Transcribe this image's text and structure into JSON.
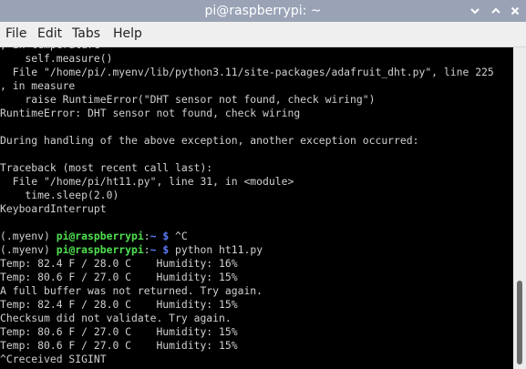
{
  "window": {
    "title": "pi@raspberrypi: ~",
    "controls": [
      "chevron-down-icon",
      "chevron-up-icon",
      "close-icon"
    ]
  },
  "menu": {
    "items": [
      "File",
      "Edit",
      "Tabs",
      "Help"
    ]
  },
  "terminal": {
    "lines": [
      ", in temperature",
      "    self.measure()",
      "  File \"/home/pi/.myenv/lib/python3.11/site-packages/adafruit_dht.py\", line 225",
      ", in measure",
      "    raise RuntimeError(\"DHT sensor not found, check wiring\")",
      "RuntimeError: DHT sensor not found, check wiring",
      "",
      "During handling of the above exception, another exception occurred:",
      "",
      "Traceback (most recent call last):",
      "  File \"/home/pi/ht11.py\", line 31, in <module>",
      "    time.sleep(2.0)",
      "KeyboardInterrupt",
      "",
      {
        "prompt": true,
        "env": "(.myenv) ",
        "host": "pi@raspberrypi",
        "sep": ":",
        "path": "~ $",
        "cmd": " ^C"
      },
      {
        "prompt": true,
        "env": "(.myenv) ",
        "host": "pi@raspberrypi",
        "sep": ":",
        "path": "~ $",
        "cmd": " python ht11.py"
      },
      "Temp: 82.4 F / 28.0 C    Humidity: 16%",
      "Temp: 80.6 F / 27.0 C    Humidity: 15%",
      "A full buffer was not returned. Try again.",
      "Temp: 82.4 F / 28.0 C    Humidity: 15%",
      "Checksum did not validate. Try again.",
      "Temp: 80.6 F / 27.0 C    Humidity: 15%",
      "Temp: 80.6 F / 27.0 C    Humidity: 15%",
      "^Creceived SIGINT"
    ]
  },
  "colors": {
    "titlebar": "#9aa3b6",
    "menubar": "#efefef",
    "terminal_bg": "#000000",
    "terminal_fg": "#d0d0d0",
    "prompt_host": "#4fe04f",
    "prompt_path": "#5c7cfb"
  }
}
